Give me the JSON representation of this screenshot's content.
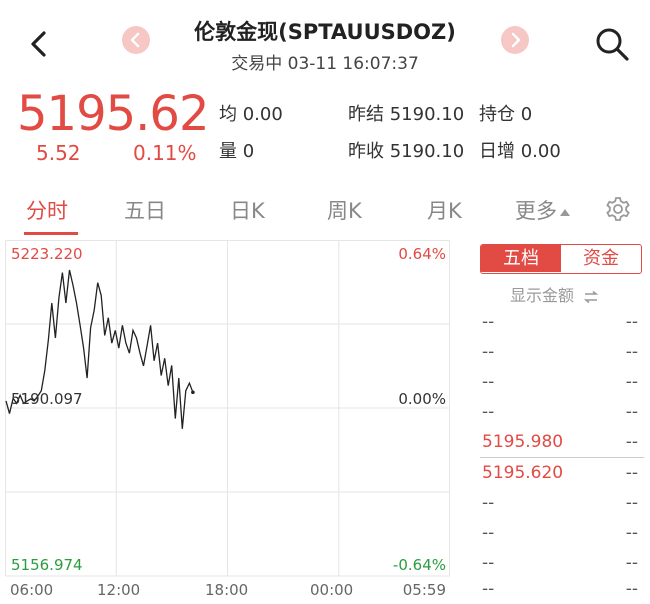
{
  "header": {
    "title": "伦敦金现(SPTAUUSDOZ)",
    "subtitle": "交易中 03-11 16:07:37",
    "icons": {
      "back": "back-icon",
      "prev": "prev-arrow-icon",
      "next": "next-arrow-icon",
      "search": "search-icon"
    }
  },
  "quote": {
    "price": "5195.62",
    "change": "5.52",
    "change_pct": "0.11%",
    "avg_label": "均",
    "avg_value": "0.00",
    "vol_label": "量",
    "vol_value": "0",
    "prev_close_label": "昨结",
    "prev_close_value": "5190.10",
    "open_interest_label": "持仓",
    "open_interest_value": "0",
    "yesterday_close_label": "昨收",
    "yesterday_close_value": "5190.10",
    "daily_inc_label": "日增",
    "daily_inc_value": "0.00"
  },
  "tabs": [
    {
      "label": "分时",
      "active": true
    },
    {
      "label": "五日"
    },
    {
      "label": "日K"
    },
    {
      "label": "周K"
    },
    {
      "label": "月K"
    },
    {
      "label": "更多"
    }
  ],
  "settings_icon": "gear-icon",
  "chart": {
    "top_price": "5223.220",
    "top_pct": "0.64%",
    "mid_price": "5190.097",
    "mid_pct": "0.00%",
    "bottom_price": "5156.974",
    "bottom_pct": "-0.64%",
    "time_labels": [
      "06:00",
      "12:00",
      "18:00",
      "00:00",
      "05:59"
    ],
    "colors": {
      "up": "#e24a44",
      "down": "#2a9d3e",
      "line": "#222222",
      "grid": "#e6e6e6"
    }
  },
  "chart_data": {
    "type": "line",
    "ylim": [
      5156.974,
      5223.22
    ],
    "x_ticks": [
      "06:00",
      "12:00",
      "18:00",
      "00:00",
      "05:59"
    ],
    "session_fraction_filled": 0.42,
    "values": [
      5191.5,
      5189.0,
      5192.0,
      5191.0,
      5192.6,
      5191.0,
      5191.5,
      5191.9,
      5191.5,
      5192.4,
      5193.5,
      5197.5,
      5203.4,
      5210.8,
      5203.9,
      5211.8,
      5216.8,
      5210.8,
      5217.3,
      5214.3,
      5210.8,
      5206.4,
      5201.9,
      5196.0,
      5205.9,
      5209.4,
      5214.8,
      5212.3,
      5204.4,
      5207.9,
      5202.9,
      5205.4,
      5201.9,
      5206.4,
      5202.9,
      5200.9,
      5205.4,
      5203.9,
      5200.9,
      5198.4,
      5202.4,
      5206.4,
      5199.4,
      5202.9,
      5196.5,
      5199.9,
      5194.5,
      5198.5,
      5188.0,
      5196.0,
      5186.0,
      5193.5,
      5195.0,
      5193.2
    ]
  },
  "order_book": {
    "tab_five": "五档",
    "tab_funds": "资金",
    "show_amount": "显示金额",
    "swap_icon": "swap-icon",
    "sells": [
      {
        "price": "--",
        "vol": "--"
      },
      {
        "price": "--",
        "vol": "--"
      },
      {
        "price": "--",
        "vol": "--"
      },
      {
        "price": "--",
        "vol": "--"
      },
      {
        "price": "5195.980",
        "vol": "--"
      }
    ],
    "buys": [
      {
        "price": "5195.620",
        "vol": "--"
      },
      {
        "price": "--",
        "vol": "--"
      },
      {
        "price": "--",
        "vol": "--"
      },
      {
        "price": "--",
        "vol": "--"
      },
      {
        "price": "--",
        "vol": "--"
      }
    ]
  }
}
